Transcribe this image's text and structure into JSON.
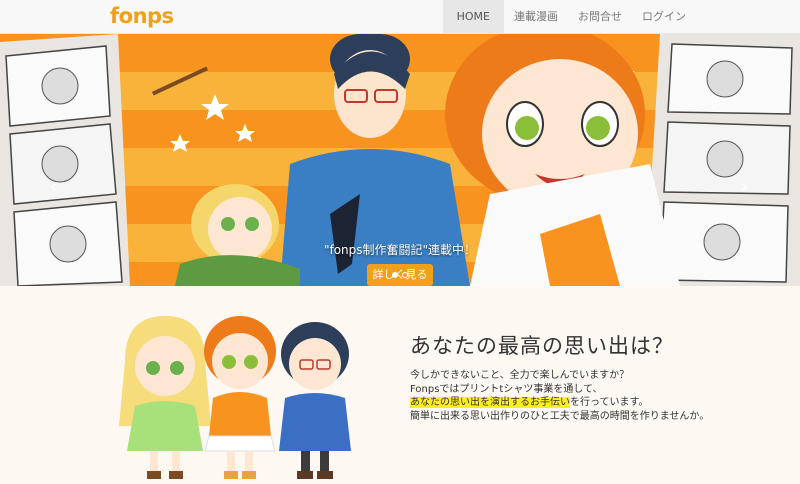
{
  "brand": {
    "logo": "fonps",
    "accent": "#f0a019"
  },
  "nav": {
    "items": [
      {
        "label": "HOME",
        "active": true
      },
      {
        "label": "連載漫画",
        "active": false
      },
      {
        "label": "お問合せ",
        "active": false
      },
      {
        "label": "ログイン",
        "active": false
      }
    ]
  },
  "hero": {
    "caption": "\"fonps制作奮闘記\"連載中！",
    "button_label": "詳しく見る",
    "slides": 2,
    "active_slide": 1
  },
  "about": {
    "title": "あなたの最高の思い出は？",
    "line1": "今しかできないこと、全力で楽しんでいますか？",
    "line2": "Fonpsではプリントtシャツ事業を通して、",
    "line3_highlight": "あなたの思い出を演出するお手伝い",
    "line3_rest": "を行っています。",
    "line4": "簡単に出来る思い出作りのひと工夫で最高の時間を作りませんか。"
  }
}
